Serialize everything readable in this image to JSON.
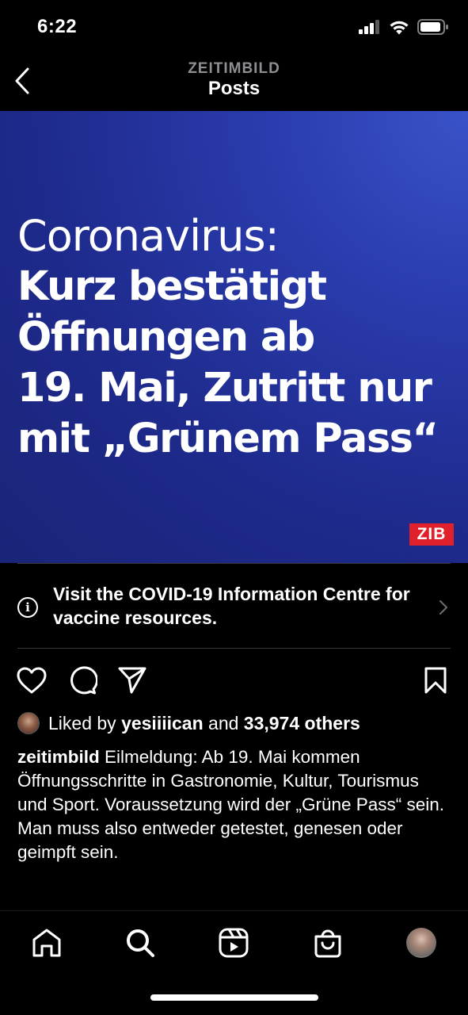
{
  "status_bar": {
    "time": "6:22"
  },
  "header": {
    "subtitle": "ZEITIMBILD",
    "title": "Posts"
  },
  "post": {
    "headline_line1": "Coronavirus:",
    "headline_bold": "Kurz bestätigt\nÖffnungen ab\n19. Mai, Zutritt nur\nmit „Grünem Pass“",
    "badge": "ZIB",
    "background_color": "#1e2a8c",
    "badge_color": "#e0202a"
  },
  "covid_banner": {
    "text": "Visit the COVID-19 Information Centre for vaccine resources.",
    "icon": "info-icon"
  },
  "actions": {
    "like_icon": "heart-icon",
    "comment_icon": "comment-icon",
    "share_icon": "send-icon",
    "save_icon": "bookmark-icon"
  },
  "likes": {
    "prefix": "Liked by",
    "user": "yesiiiican",
    "middle": "and",
    "others": "33,974 others"
  },
  "caption": {
    "username": "zeitimbild",
    "text": "Eilmeldung: Ab 19. Mai kommen Öffnungsschritte in Gastronomie, Kultur, Tourismus und Sport. Voraussetzung wird der „Grüne Pass“ sein. Man muss also entweder getestet, genesen oder geimpft sein."
  },
  "tab_bar": {
    "items": [
      "home-icon",
      "search-icon",
      "reels-icon",
      "shop-icon",
      "profile-avatar"
    ]
  }
}
